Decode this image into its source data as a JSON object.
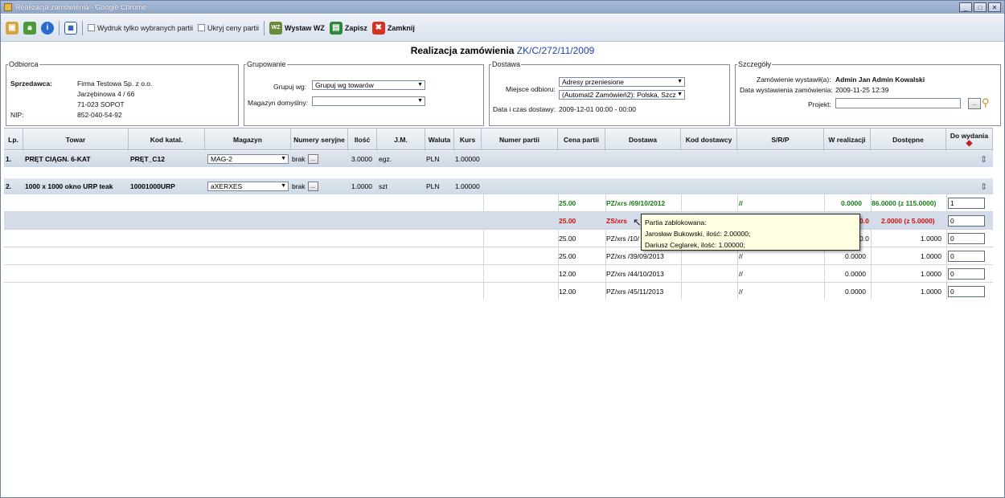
{
  "window": {
    "title": "Realizacja zamówienia - Google Chrome"
  },
  "toolbar": {
    "chk_partie": "Wydruk tylko wybranych partii",
    "chk_ceny": "Ukryj ceny partii",
    "btn_wz": "Wystaw WZ",
    "btn_save": "Zapisz",
    "btn_close": "Zamknij"
  },
  "header": {
    "title": "Realizacja zamówienia",
    "number": "ZK/C/272/11/2009"
  },
  "odbiorca": {
    "legend": "Odbiorca",
    "seller_label": "Sprzedawca:",
    "name": "Firma Testowa Sp. z o.o.",
    "street": "Jarzębinowa 4 / 66",
    "city": "71-023 SOPOT",
    "nip_label": "NIP:",
    "nip": "852-040-54-92"
  },
  "grupowanie": {
    "legend": "Grupowanie",
    "group_label": "Grupuj wg:",
    "group_value": "Grupuj wg towarów",
    "mag_label": "Magazyn domyślny:",
    "mag_value": ""
  },
  "dostawa": {
    "legend": "Dostawa",
    "place_label": "Miejsce odbioru:",
    "place_value": "Adresy przeniesione",
    "place_value2": "(Automat2 Zamówień2): Polska, Szcz",
    "date_label": "Data i czas dostawy:",
    "date_value": "2009-12-01 00:00 - 00:00"
  },
  "szczegoly": {
    "legend": "Szczegóły",
    "issuer_label": "Zamówienie wystawił(a):",
    "issuer_value": "Admin Jan Admin Kowalski",
    "issued_label": "Data wystawienia zamówienia:",
    "issued_value": "2009-11-25 12:39",
    "project_label": "Projekt:",
    "project_value": ""
  },
  "columns": [
    "Lp.",
    "Towar",
    "Kod katal.",
    "Magazyn",
    "Numery seryjne",
    "Ilość",
    "J.M.",
    "Waluta",
    "Kurs",
    "Numer partii",
    "Cena partii",
    "Dostawa",
    "Kod dostawcy",
    "S/R/P",
    "W realizacji",
    "Dostępne",
    "Do wydania"
  ],
  "items": [
    {
      "lp": "1.",
      "towar": "PRĘT CIĄGN. 6-KAT",
      "kod": "PRĘT_C12",
      "magazyn": "MAG-2",
      "serial": "brak",
      "ilosc": "3.0000",
      "jm": "egz.",
      "waluta": "PLN",
      "kurs": "1.00000"
    },
    {
      "lp": "2.",
      "towar": "1000 x 1000 okno URP teak",
      "kod": "10001000URP",
      "magazyn": "aXERXES",
      "serial": "brak",
      "ilosc": "1.0000",
      "jm": "szt",
      "waluta": "PLN",
      "kurs": "1.00000"
    }
  ],
  "batches": [
    {
      "cena": "25.00",
      "dostawa": "PZ/xrs /69/10/2012",
      "srp": "//",
      "wreal": "0.0000",
      "dost": "86.0000 (z 115.0000)",
      "qty": "1"
    },
    {
      "cena": "25.00",
      "dostawa": "ZS/xrs",
      "srp": "",
      "wreal": "0.0000",
      "dost": "2.0000 (z 5.0000)",
      "qty": "0"
    },
    {
      "cena": "25.00",
      "dostawa": "PZ/xrs /10/",
      "srp": "",
      "wreal": "0.0000",
      "dost": "1.0000",
      "qty": "0"
    },
    {
      "cena": "25.00",
      "dostawa": "PZ/xrs /39/09/2013",
      "srp": "//",
      "wreal": "0.0000",
      "dost": "1.0000",
      "qty": "0"
    },
    {
      "cena": "12.00",
      "dostawa": "PZ/xrs /44/10/2013",
      "srp": "//",
      "wreal": "0.0000",
      "dost": "1.0000",
      "qty": "0"
    },
    {
      "cena": "12.00",
      "dostawa": "PZ/xrs /45/11/2013",
      "srp": "//",
      "wreal": "0.0000",
      "dost": "1.0000",
      "qty": "0"
    }
  ],
  "tooltip": {
    "line1": "Partia zablokowana:",
    "line2": "Jarosław Bukowski, ilość: 2.00000;",
    "line3": "Dariusz Ceglarek, ilość: 1.00000;"
  }
}
